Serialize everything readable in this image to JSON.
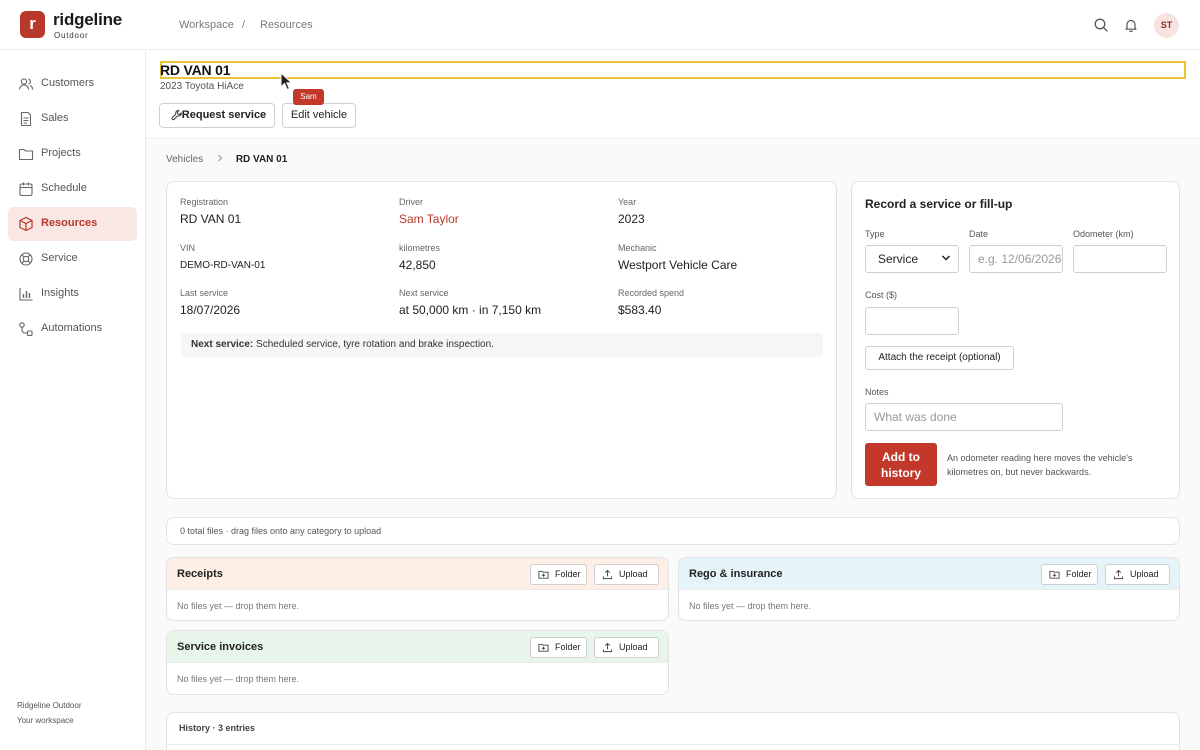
{
  "brand": {
    "logo_letter": "r",
    "name": "ridgeline",
    "sub": "Outdoor"
  },
  "top_breadcrumb": [
    "Workspace",
    "/",
    "Resources"
  ],
  "user": {
    "initials": "ST"
  },
  "sidebar": {
    "items": [
      {
        "label": "Customers",
        "icon": "users-icon"
      },
      {
        "label": "Sales",
        "icon": "document-icon"
      },
      {
        "label": "Projects",
        "icon": "folder-icon"
      },
      {
        "label": "Schedule",
        "icon": "calendar-icon"
      },
      {
        "label": "Resources",
        "icon": "box-icon",
        "active": true
      },
      {
        "label": "Service",
        "icon": "lifebuoy-icon"
      },
      {
        "label": "Insights",
        "icon": "bar-chart-icon"
      },
      {
        "label": "Automations",
        "icon": "flow-icon"
      }
    ],
    "footer": {
      "org": "Ridgeline Outdoor",
      "sub": "Your workspace"
    }
  },
  "header": {
    "title": "RD VAN 01",
    "subtitle": "2023 Toyota HiAce",
    "request_service": "Request service",
    "edit_vehicle": "Edit vehicle",
    "tooltip": "Sam"
  },
  "breadcrumb": {
    "parent": "Vehicles",
    "current": "RD VAN 01"
  },
  "vehicle": {
    "registration": {
      "label": "Registration",
      "value": "RD VAN 01"
    },
    "driver": {
      "label": "Driver",
      "value": "Sam Taylor"
    },
    "year": {
      "label": "Year",
      "value": "2023"
    },
    "vin": {
      "label": "VIN",
      "value": "DEMO-RD-VAN-01"
    },
    "kilometres": {
      "label": "kilometres",
      "value": "42,850"
    },
    "mechanic": {
      "label": "Mechanic",
      "value": "Westport Vehicle Care"
    },
    "last_service": {
      "label": "Last service",
      "value": "18/07/2026"
    },
    "next_service": {
      "label": "Next service",
      "value": "at 50,000 km · in 7,150 km"
    },
    "recorded_spend": {
      "label": "Recorded spend",
      "value": "$583.40"
    },
    "note": {
      "label": "Next service:",
      "text": " Scheduled service, tyre rotation and brake inspection."
    }
  },
  "record_form": {
    "title": "Record a service or fill-up",
    "type_label": "Type",
    "type_value": "Service",
    "date_label": "Date",
    "date_placeholder": "e.g. 12/06/2026",
    "odometer_label": "Odometer (km)",
    "odometer_value": "",
    "cost_label": "Cost ($)",
    "cost_value": "",
    "attach_label": "Attach the receipt (optional)",
    "notes_label": "Notes",
    "notes_placeholder": "What was done",
    "submit_line1": "Add to",
    "submit_line2": "history",
    "help": "An odometer reading here moves the vehicle's kilometres on, but never backwards."
  },
  "files": {
    "summary": "0 total files · drag files onto any category to upload",
    "folder_label": "Folder",
    "upload_label": "Upload",
    "empty": "No files yet — drop them here.",
    "categories": [
      {
        "title": "Receipts",
        "color": "#fdeee6"
      },
      {
        "title": "Rego & insurance",
        "color": "#e4f4f9"
      },
      {
        "title": "Service invoices",
        "color": "#e8f5ea"
      }
    ]
  },
  "history": {
    "title": "History · 3 entries"
  },
  "colors": {
    "accent": "#c2392b",
    "highlight_box": "#e8c531"
  }
}
